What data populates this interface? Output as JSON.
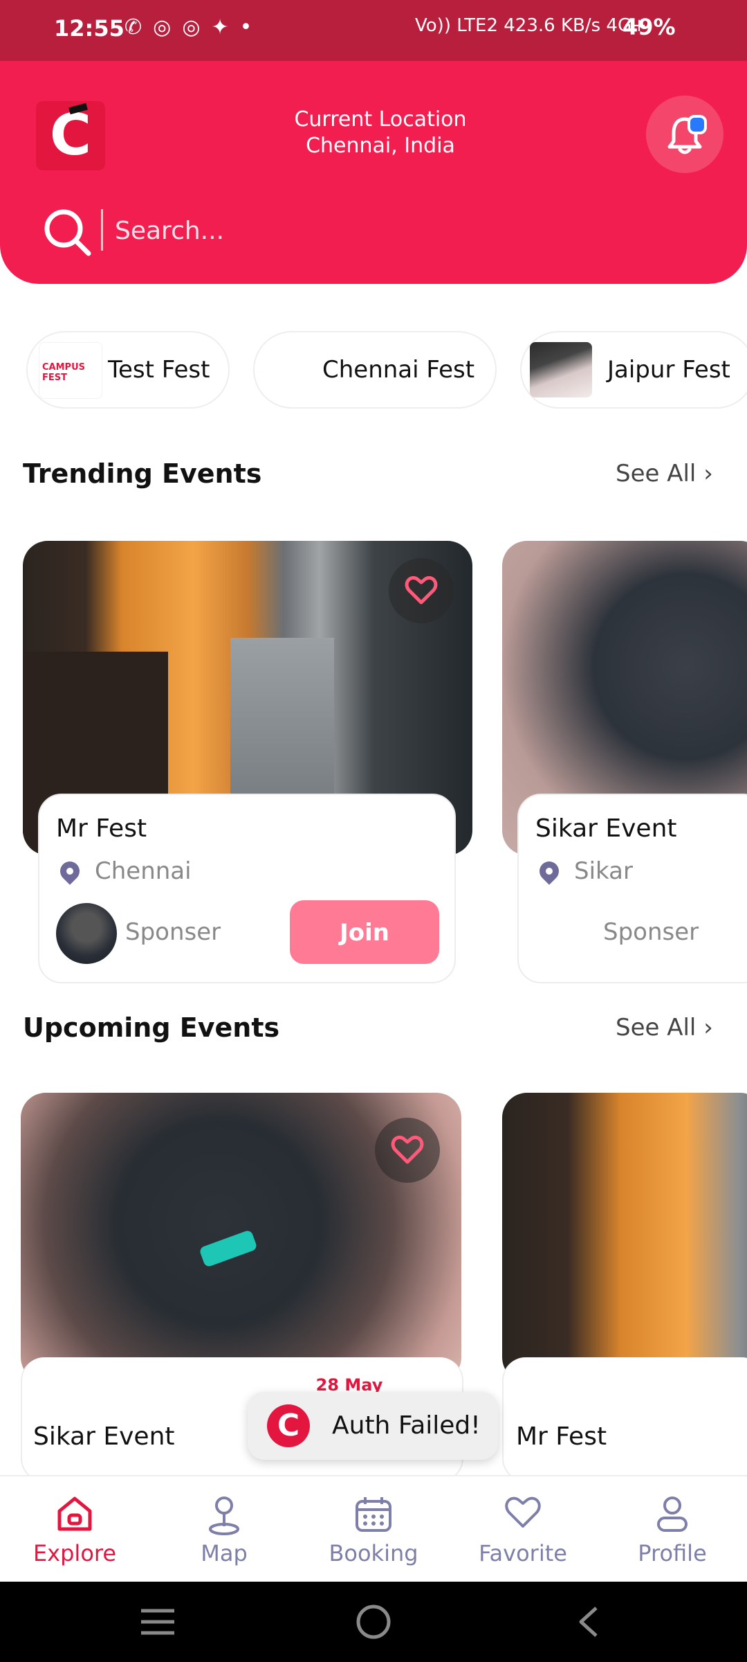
{
  "status_bar": {
    "time": "12:55",
    "network_text": "Vo)) LTE2  423.6 KB/s  4G+",
    "battery": "49%"
  },
  "header": {
    "location_title": "Current Location",
    "location_value": "Chennai, India",
    "search_placeholder": "Search..."
  },
  "categories": [
    {
      "label": "Test Fest",
      "thumb_text": "CAMPUS FEST"
    },
    {
      "label": "Chennai Fest"
    },
    {
      "label": "Jaipur Fest"
    }
  ],
  "trending": {
    "title": "Trending Events",
    "see_all": "See All",
    "cards": [
      {
        "title": "Mr Fest",
        "location": "Chennai",
        "sponsor": "Sponser",
        "join_label": "Join"
      },
      {
        "title": "Sikar Event",
        "location": "Sikar",
        "sponsor": "Sponser"
      }
    ]
  },
  "upcoming": {
    "title": "Upcoming Events",
    "see_all": "See All",
    "cards": [
      {
        "title": "Sikar Event",
        "date": "28 May"
      },
      {
        "title": "Mr Fest"
      }
    ]
  },
  "toast": {
    "message": "Auth Failed!"
  },
  "bottom_nav": [
    {
      "label": "Explore",
      "icon": "home-icon",
      "active": true
    },
    {
      "label": "Map",
      "icon": "map-pin-icon"
    },
    {
      "label": "Booking",
      "icon": "calendar-icon"
    },
    {
      "label": "Favorite",
      "icon": "heart-icon"
    },
    {
      "label": "Profile",
      "icon": "user-icon"
    }
  ],
  "colors": {
    "brand": "#f21e4f",
    "status_bar": "#b81f3d",
    "join_button": "#ff7a94",
    "nav_active": "#e3163f",
    "nav_inactive": "#7d7fa8"
  }
}
